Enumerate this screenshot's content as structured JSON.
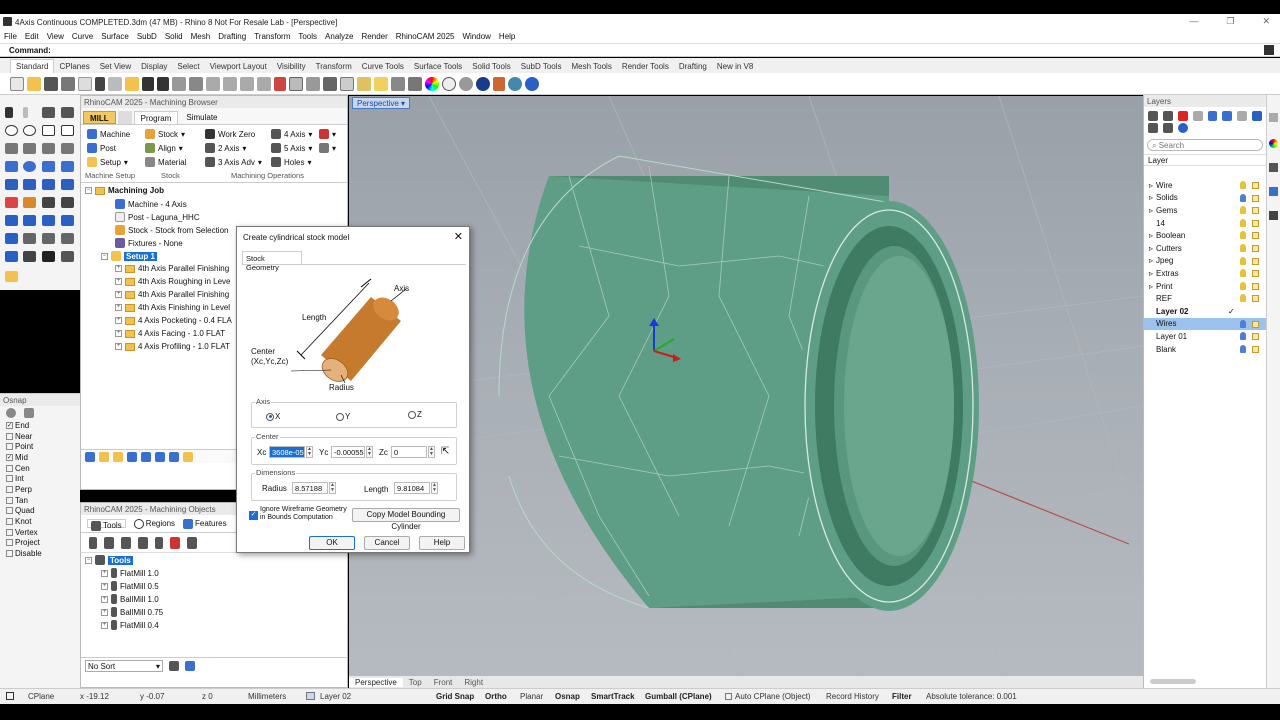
{
  "window": {
    "title": "4Axis Continuous COMPLETED.3dm (47 MB) - Rhino 8 Not For Resale Lab - [Perspective]"
  },
  "menu": [
    "File",
    "Edit",
    "View",
    "Curve",
    "Surface",
    "SubD",
    "Solid",
    "Mesh",
    "Drafting",
    "Transform",
    "Tools",
    "Analyze",
    "Render",
    "RhinoCAM 2025",
    "Window",
    "Help"
  ],
  "command": {
    "label": "Command:"
  },
  "toolbar_tabs": [
    "Standard",
    "CPlanes",
    "Set View",
    "Display",
    "Select",
    "Viewport Layout",
    "Visibility",
    "Transform",
    "Curve Tools",
    "Surface Tools",
    "Solid Tools",
    "SubD Tools",
    "Mesh Tools",
    "Render Tools",
    "Drafting",
    "New in V8"
  ],
  "machining_browser": {
    "title": "RhinoCAM 2025 - Machining Browser",
    "tabs": {
      "mill": "MILL",
      "program": "Program",
      "simulate": "Simulate"
    },
    "ribbon": {
      "machine": "Machine",
      "post": "Post",
      "setup": "Setup",
      "stock": "Stock",
      "align": "Align",
      "material": "Material",
      "work_zero": "Work Zero",
      "two_axis": "2 Axis",
      "three_axis_adv": "3 Axis Adv",
      "four_axis": "4 Axis",
      "five_axis": "5 Axis",
      "holes": "Holes"
    },
    "captions": {
      "machine_setup": "Machine Setup",
      "stock": "Stock",
      "machining_ops": "Machining Operations"
    },
    "tree": {
      "root": "Machining Job",
      "machine": "Machine - 4 Axis",
      "post": "Post - Laguna_HHC",
      "stock": "Stock - Stock from Selection",
      "fixtures": "Fixtures - None",
      "setup": "Setup 1",
      "ops": [
        "4th Axis Parallel Finishing",
        "4th Axis Roughing in Leve",
        "4th Axis Parallel Finishing",
        "4th Axis Finishing in Level",
        "4 Axis Pocketing - 0.4 FLA",
        "4 Axis Facing - 1.0 FLAT",
        "4 Axis Profiling - 1.0 FLAT"
      ]
    }
  },
  "machining_objects": {
    "title": "RhinoCAM 2025 - Machining Objects",
    "tabs": {
      "tools": "Tools",
      "regions": "Regions",
      "features": "Features"
    },
    "root": "Tools",
    "tools": [
      "FlatMill 1.0",
      "FlatMill 0.5",
      "BallMill 1.0",
      "BallMill 0.75",
      "FlatMill 0.4"
    ],
    "sort": "No Sort"
  },
  "osnap": {
    "title": "Osnap",
    "items": [
      {
        "label": "End",
        "checked": true
      },
      {
        "label": "Near",
        "checked": false
      },
      {
        "label": "Point",
        "checked": false
      },
      {
        "label": "Mid",
        "checked": true
      },
      {
        "label": "Cen",
        "checked": false
      },
      {
        "label": "Int",
        "checked": false
      },
      {
        "label": "Perp",
        "checked": false
      },
      {
        "label": "Tan",
        "checked": false
      },
      {
        "label": "Quad",
        "checked": false
      },
      {
        "label": "Knot",
        "checked": false
      },
      {
        "label": "Vertex",
        "checked": false
      },
      {
        "label": "Project",
        "checked": false
      },
      {
        "label": "Disable",
        "checked": false
      }
    ]
  },
  "viewport": {
    "name": "Perspective",
    "tabs": [
      "Perspective",
      "Top",
      "Front",
      "Right"
    ],
    "model_color": "#5f9e86"
  },
  "dialog": {
    "title": "Create cylindrical stock model",
    "tab": "Stock Geometry",
    "diagram": {
      "axis": "Axis",
      "length": "Length",
      "center": "Center",
      "center_sub": "(Xc,Yc,Zc)",
      "radius": "Radius"
    },
    "axis_group": "Axis",
    "axis_options": [
      "X",
      "Y",
      "Z"
    ],
    "axis_selected": "X",
    "center_group": "Center",
    "xc_label": "Xc",
    "xc_value": "3608e-05",
    "yc_label": "Yc",
    "yc_value": "-0.000555",
    "zc_label": "Zc",
    "zc_value": "0",
    "dim_group": "Dimensions",
    "radius_label": "Radius",
    "radius_value": "8.57188",
    "length_label": "Length",
    "length_value": "9.81084",
    "ignore_wireframe": "Ignore Wireframe Geometry in Bounds Computation",
    "ignore_checked": true,
    "copy_button": "Copy Model Bounding Cylinder",
    "ok": "OK",
    "cancel": "Cancel",
    "help": "Help"
  },
  "layers": {
    "title": "Layers",
    "search_placeholder": "Search",
    "header": "Layer",
    "items": [
      {
        "name": "Wire",
        "bulb": "#e6c23a"
      },
      {
        "name": "Solids",
        "bulb": "#4d7fd6"
      },
      {
        "name": "Gems",
        "bulb": "#e6c23a"
      },
      {
        "name": "14",
        "bulb": "#e6c23a"
      },
      {
        "name": "Boolean",
        "bulb": "#e6c23a"
      },
      {
        "name": "Cutters",
        "bulb": "#e6c23a"
      },
      {
        "name": "Jpeg",
        "bulb": "#e6c23a"
      },
      {
        "name": "Extras",
        "bulb": "#e6c23a"
      },
      {
        "name": "Print",
        "bulb": "#e6c23a"
      },
      {
        "name": "REF",
        "bulb": "#e6c23a"
      },
      {
        "name": "Layer 02",
        "bulb": ""
      },
      {
        "name": "Wires",
        "bulb": "#4d7fd6"
      },
      {
        "name": "Layer 01",
        "bulb": "#4d7fd6"
      },
      {
        "name": "Blank",
        "bulb": "#4d7fd6"
      }
    ]
  },
  "status": {
    "cplane": "CPlane",
    "x": "x -19.12",
    "y": "y -0.07",
    "z": "z 0",
    "units": "Millimeters",
    "layer": "Layer 02",
    "grid_snap": "Grid Snap",
    "ortho": "Ortho",
    "planar": "Planar",
    "osnap": "Osnap",
    "smarttrack": "SmartTrack",
    "gumball": "Gumball (CPlane)",
    "auto_cplane": "Auto CPlane (Object)",
    "record_history": "Record History",
    "filter": "Filter",
    "tolerance": "Absolute tolerance: 0.001"
  }
}
